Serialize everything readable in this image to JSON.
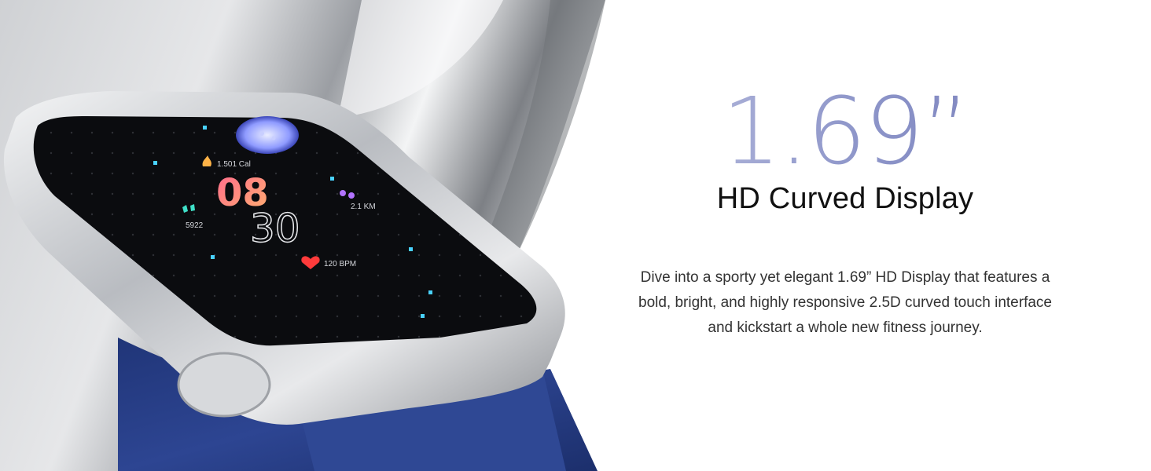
{
  "headline": {
    "size": "1.69”",
    "subtitle": "HD Curved Display"
  },
  "description": {
    "lines": [
      "Dive into a sporty yet elegant 1.69” HD Display that features a",
      "bold, bright, and highly responsive 2.5D curved touch interface",
      "and kickstart a whole new fitness journey."
    ]
  },
  "watch_face": {
    "calories": "1.501 Cal",
    "hour": "08",
    "minute": "30",
    "steps": "5922",
    "distance": "2.1 KM",
    "heart_rate": "120 BPM"
  },
  "colors": {
    "headline_gradient_start": "#b4b9dc",
    "headline_gradient_end": "#7c83bd",
    "strap": "#2a3f86",
    "case": "#c9cbcf",
    "hour_gradient_start": "#ff6a8c",
    "hour_gradient_end": "#ffb070"
  }
}
